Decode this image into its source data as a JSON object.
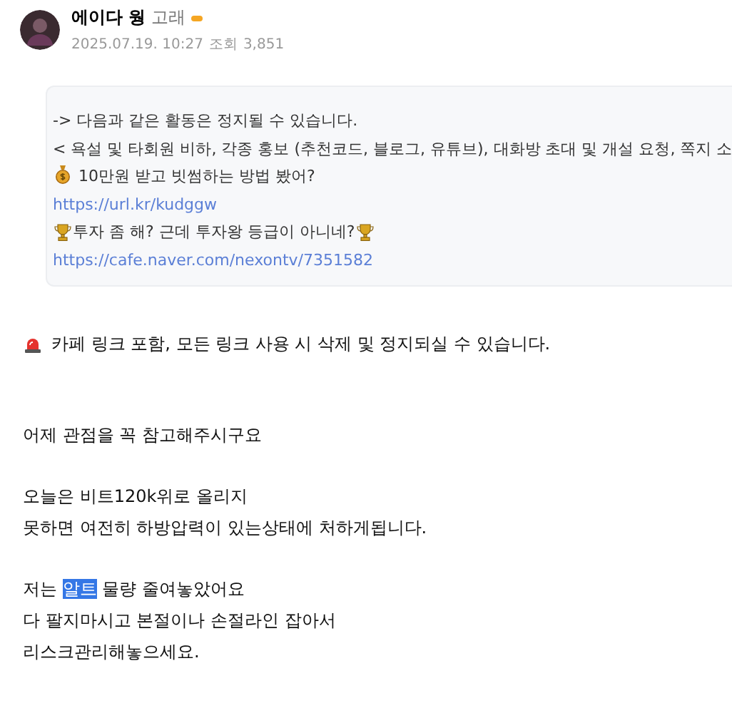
{
  "author": {
    "name": "에이다 웡",
    "grade": "고래",
    "date": "2025.07.19. 10:27",
    "views_label": "조회",
    "views": "3,851"
  },
  "notice": [
    {
      "kind": "text",
      "text": "-> 다음과 같은 활동은 정지될 수 있습니다."
    },
    {
      "kind": "text",
      "text": "< 욕설 및 타회원 비하, 각종 홍보 (추천코드, 블로그, 유튜브), 대화방 초대 및 개설 요청, 쪽지 소"
    },
    {
      "kind": "money",
      "text": "10만원 받고 빗썸하는 방법 봤어?"
    },
    {
      "kind": "link",
      "text": "https://url.kr/kudggw"
    },
    {
      "kind": "trophy",
      "text": "투자 좀 해? 근데 투자왕 등급이 아니네?"
    },
    {
      "kind": "link",
      "text": "https://cafe.naver.com/nexontv/7351582"
    }
  ],
  "alert": "카페 링크 포함, 모든 링크 사용 시 삭제 및 정지되실 수 있습니다.",
  "paragraphs": [
    [
      [
        {
          "text": "어제 관점을 꼭 참고해주시구요",
          "selected": false
        }
      ]
    ],
    [
      [
        {
          "text": "오늘은 비트120k위로 올리지",
          "selected": false
        }
      ],
      [
        {
          "text": "못하면 여전히 하방압력이 있는상태에 처하게됩니다.",
          "selected": false
        }
      ]
    ],
    [
      [
        {
          "text": "저는 ",
          "selected": false
        },
        {
          "text": "알트",
          "selected": true
        },
        {
          "text": " 물량 줄여놓았어요",
          "selected": false
        }
      ],
      [
        {
          "text": "다 팔지마시고 본절이나 손절라인 잡아서",
          "selected": false
        }
      ],
      [
        {
          "text": "리스크관리해놓으세요.",
          "selected": false
        }
      ]
    ]
  ]
}
